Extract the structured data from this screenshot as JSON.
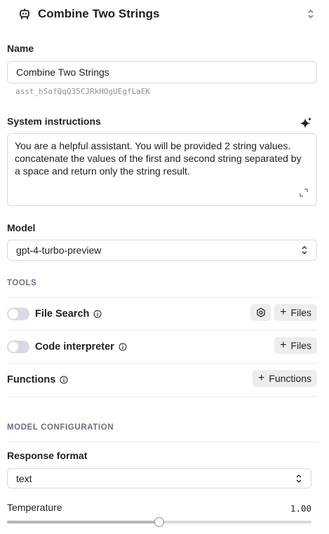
{
  "header": {
    "title": "Combine Two Strings",
    "icon": "robot-icon"
  },
  "name": {
    "label": "Name",
    "value": "Combine Two Strings",
    "assistant_id": "asst_hSofQqQ35CJRkHOgUEgfLaEK"
  },
  "instructions": {
    "label": "System instructions",
    "text": "You are a helpful assistant.  You will be provided 2 string values. concatenate the values of the first and second string separated by a space and return only the string result."
  },
  "model": {
    "label": "Model",
    "value": "gpt-4-turbo-preview"
  },
  "tools": {
    "heading": "TOOLS",
    "file_search": {
      "label": "File Search",
      "files_button": "Files",
      "enabled": false
    },
    "code_interpreter": {
      "label": "Code interpreter",
      "files_button": "Files",
      "enabled": false
    },
    "functions": {
      "label": "Functions",
      "button": "Functions"
    }
  },
  "model_config": {
    "heading": "MODEL CONFIGURATION",
    "response_format": {
      "label": "Response format",
      "value": "text"
    },
    "temperature": {
      "label": "Temperature",
      "value": "1.00",
      "fraction": 0.5
    }
  },
  "colors": {
    "border": "#d9d9e3",
    "pill": "#ececf1",
    "muted": "#6e6e80"
  }
}
